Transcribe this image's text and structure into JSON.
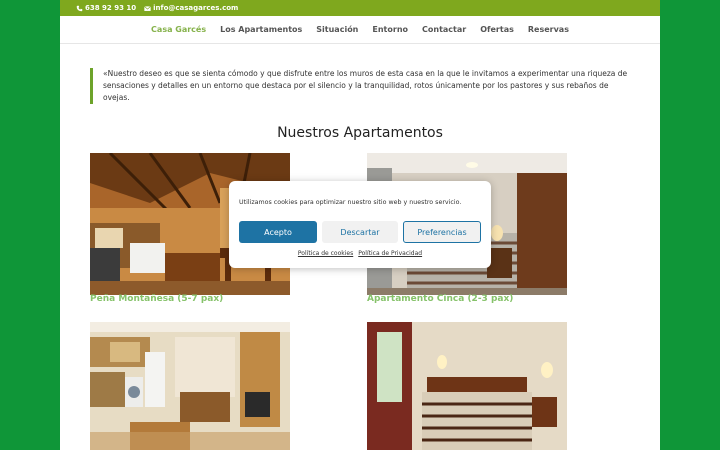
{
  "topbar": {
    "phone": "638 92 93 10",
    "email": "info@casagarces.com"
  },
  "nav": {
    "items": [
      "Casa Garcés",
      "Los Apartamentos",
      "Situación",
      "Entorno",
      "Contactar",
      "Ofertas",
      "Reservas"
    ],
    "active_index": 0
  },
  "intro_quote": "«Nuestro deseo es que se sienta cómodo y que disfrute entre los muros de esta casa en la que le invitamos a experimentar una riqueza de sensaciones y detalles en un entorno que destaca por el silencio y la tranquilidad, rotos únicamente por los pastores y sus rebaños de ovejas.",
  "section_title": "Nuestros Apartamentos",
  "apartments": [
    {
      "name": "Peña Montañesa (5-7 pax)"
    },
    {
      "name": "Apartamento Cinca (2-3 pax)"
    }
  ],
  "cookie_banner": {
    "message": "Utilizamos cookies para optimizar nuestro sitio web y nuestro servicio.",
    "accept_label": "Acepto",
    "deny_label": "Descartar",
    "preferences_label": "Preferencias",
    "cookie_policy_link": "Política de cookies",
    "privacy_policy_link": "Política de Privacidad"
  },
  "colors": {
    "page_background": "#0f9638",
    "topbar": "#7fa81e",
    "nav_active": "#86b24b",
    "caption": "#86c26a",
    "button_primary": "#1e73a4"
  }
}
